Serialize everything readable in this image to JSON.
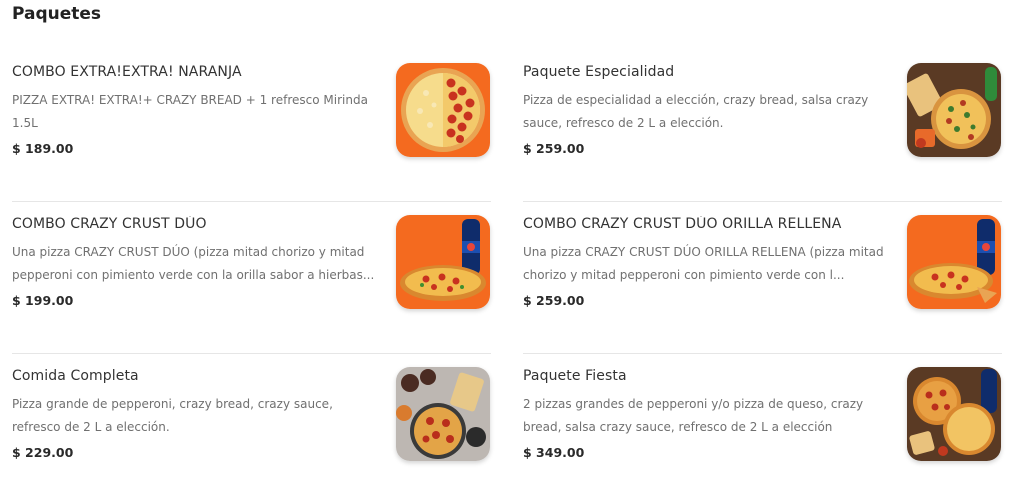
{
  "section": {
    "title": "Paquetes"
  },
  "products": [
    {
      "name": "COMBO EXTRA!EXTRA! NARANJA",
      "description": "PIZZA EXTRA! EXTRA!+ CRAZY BREAD + 1 refresco Mirinda 1.5L",
      "price": "$ 189.00",
      "image": "pizza-half-pepperoni-orange-bg"
    },
    {
      "name": "Paquete Especialidad",
      "description": "Pizza de especialidad a elección, crazy bread, salsa crazy sauce, refresco de 2 L a elección.",
      "price": "$ 259.00",
      "image": "specialty-pizza-combo-wood-bg"
    },
    {
      "name": "COMBO CRAZY CRUST DÚO",
      "description": "Una pizza CRAZY CRUST DÚO (pizza mitad chorizo y mitad pepperoni con pimiento verde con la orilla sabor a hierbas...",
      "price": "$ 199.00",
      "image": "pizza-with-soda-orange-bg"
    },
    {
      "name": "COMBO CRAZY CRUST DÚO ORILLA RELLENA",
      "description": "Una pizza CRAZY CRUST DÚO ORILLA RELLENA (pizza mitad chorizo y mitad pepperoni con pimiento verde con l...",
      "price": "$ 259.00",
      "image": "pizza-with-soda-orange-bg"
    },
    {
      "name": "Comida Completa",
      "description": "Pizza grande de pepperoni, crazy bread, crazy sauce, refresco de 2 L a elección.",
      "price": "$ 229.00",
      "image": "pepperoni-pizza-meal-gray-bg"
    },
    {
      "name": "Paquete Fiesta",
      "description": "2 pizzas grandes de pepperoni y/o pizza de queso, crazy bread, salsa crazy sauce, refresco de 2 L a elección",
      "price": "$ 349.00",
      "image": "party-pizzas-wood-bg"
    }
  ],
  "colors": {
    "brand_orange": "#f46a1f",
    "wood": "#5a3a24",
    "price_text": "#2a2a2a",
    "desc_text": "#707070"
  }
}
